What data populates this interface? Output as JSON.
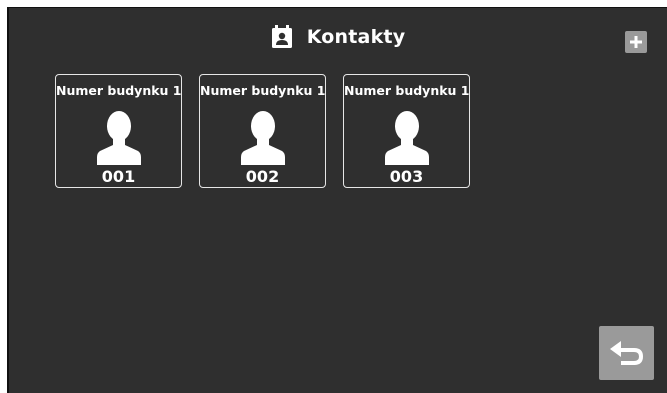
{
  "header": {
    "title": "Kontakty",
    "icon": "contact-book-icon"
  },
  "toolbar": {
    "add_icon": "plus-icon",
    "back_icon": "return-arrow-icon"
  },
  "contacts": [
    {
      "name": "Numer budynku 1",
      "number": "001",
      "icon": "person-icon"
    },
    {
      "name": "Numer budynku 1",
      "number": "002",
      "icon": "person-icon"
    },
    {
      "name": "Numer budynku 1",
      "number": "003",
      "icon": "person-icon"
    }
  ],
  "colors": {
    "background": "#2f2f2f",
    "button": "#9a9a9a",
    "text": "#ffffff",
    "card_border": "#e6e6e6"
  }
}
